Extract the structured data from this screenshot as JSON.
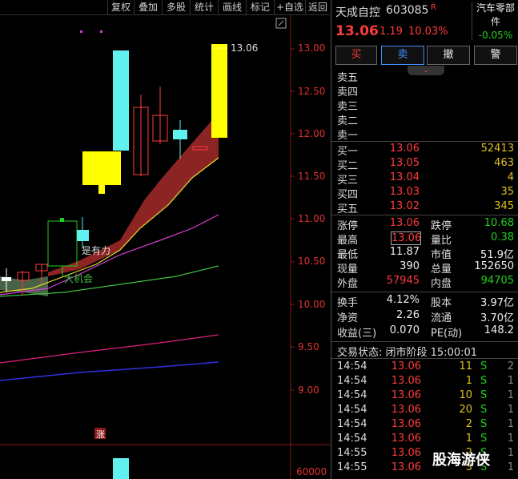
{
  "toolbar": {
    "buttons": [
      "复权",
      "叠加",
      "多股",
      "统计",
      "画线",
      "标记",
      "+自选",
      "返回"
    ]
  },
  "chart": {
    "price_axis": [
      "13.00",
      "12.50",
      "12.00",
      "11.50",
      "11.00",
      "10.50",
      "10.00",
      "9.50",
      "9.00"
    ],
    "volume_axis": "60000",
    "last_price_marker": "13.06",
    "annotation_1": "是有力",
    "annotation_2": "大机会",
    "limit_up_tag": "涨"
  },
  "header": {
    "stock_name": "天成自控",
    "stock_code": "603085",
    "rong_flag": "R",
    "sector": "汽车零部件",
    "sector_change": "-0.05%",
    "price": "13.06",
    "change": "1.19",
    "change_pct": "10.03%"
  },
  "actions": {
    "buy": "买",
    "sell": "卖",
    "cancel": "撤",
    "alert": "警"
  },
  "asks": [
    {
      "label": "卖五",
      "price": "",
      "vol": ""
    },
    {
      "label": "卖四",
      "price": "",
      "vol": ""
    },
    {
      "label": "卖三",
      "price": "",
      "vol": ""
    },
    {
      "label": "卖二",
      "price": "",
      "vol": ""
    },
    {
      "label": "卖一",
      "price": "",
      "vol": ""
    }
  ],
  "bids": [
    {
      "label": "买一",
      "price": "13.06",
      "vol": "52413"
    },
    {
      "label": "买二",
      "price": "13.05",
      "vol": "463"
    },
    {
      "label": "买三",
      "price": "13.04",
      "vol": "4"
    },
    {
      "label": "买四",
      "price": "13.03",
      "vol": "35"
    },
    {
      "label": "买五",
      "price": "13.02",
      "vol": "345"
    }
  ],
  "stats": {
    "limit_up_label": "涨停",
    "limit_up": "13.06",
    "limit_down_label": "跌停",
    "limit_down": "10.68",
    "high_label": "最高",
    "high": "13.06",
    "vol_ratio_label": "量比",
    "vol_ratio": "0.38",
    "low_label": "最低",
    "low": "11.87",
    "mcap_label": "市值",
    "mcap": "51.9亿",
    "now_vol_label": "现量",
    "now_vol": "390",
    "total_vol_label": "总量",
    "total_vol": "152650",
    "outer_label": "外盘",
    "outer": "57945",
    "inner_label": "内盘",
    "inner": "94705",
    "turnover_label": "换手",
    "turnover": "4.12%",
    "equity_label": "股本",
    "equity": "3.97亿",
    "nav_label": "净资",
    "nav": "2.26",
    "float_label": "流通",
    "float": "3.70亿",
    "eps_label": "收益(三)",
    "eps": "0.070",
    "pe_label": "PE(动)",
    "pe": "148.2"
  },
  "status": {
    "label": "交易状态: 闭市阶段 15:00:01"
  },
  "ticks": [
    {
      "time": "14:54",
      "price": "13.06",
      "vol": "11",
      "side": "S",
      "n": "2"
    },
    {
      "time": "14:54",
      "price": "13.06",
      "vol": "1",
      "side": "S",
      "n": "1"
    },
    {
      "time": "14:54",
      "price": "13.06",
      "vol": "10",
      "side": "S",
      "n": "1"
    },
    {
      "time": "14:54",
      "price": "13.06",
      "vol": "20",
      "side": "S",
      "n": "1"
    },
    {
      "time": "14:54",
      "price": "13.06",
      "vol": "2",
      "side": "S",
      "n": "1"
    },
    {
      "time": "14:54",
      "price": "13.06",
      "vol": "1",
      "side": "S",
      "n": "1"
    },
    {
      "time": "14:55",
      "price": "13.06",
      "vol": "2",
      "side": "S",
      "n": "1"
    },
    {
      "time": "14:55",
      "price": "13.06",
      "vol": "3",
      "side": "S",
      "n": "1"
    }
  ],
  "watermark": "股海游侠"
}
